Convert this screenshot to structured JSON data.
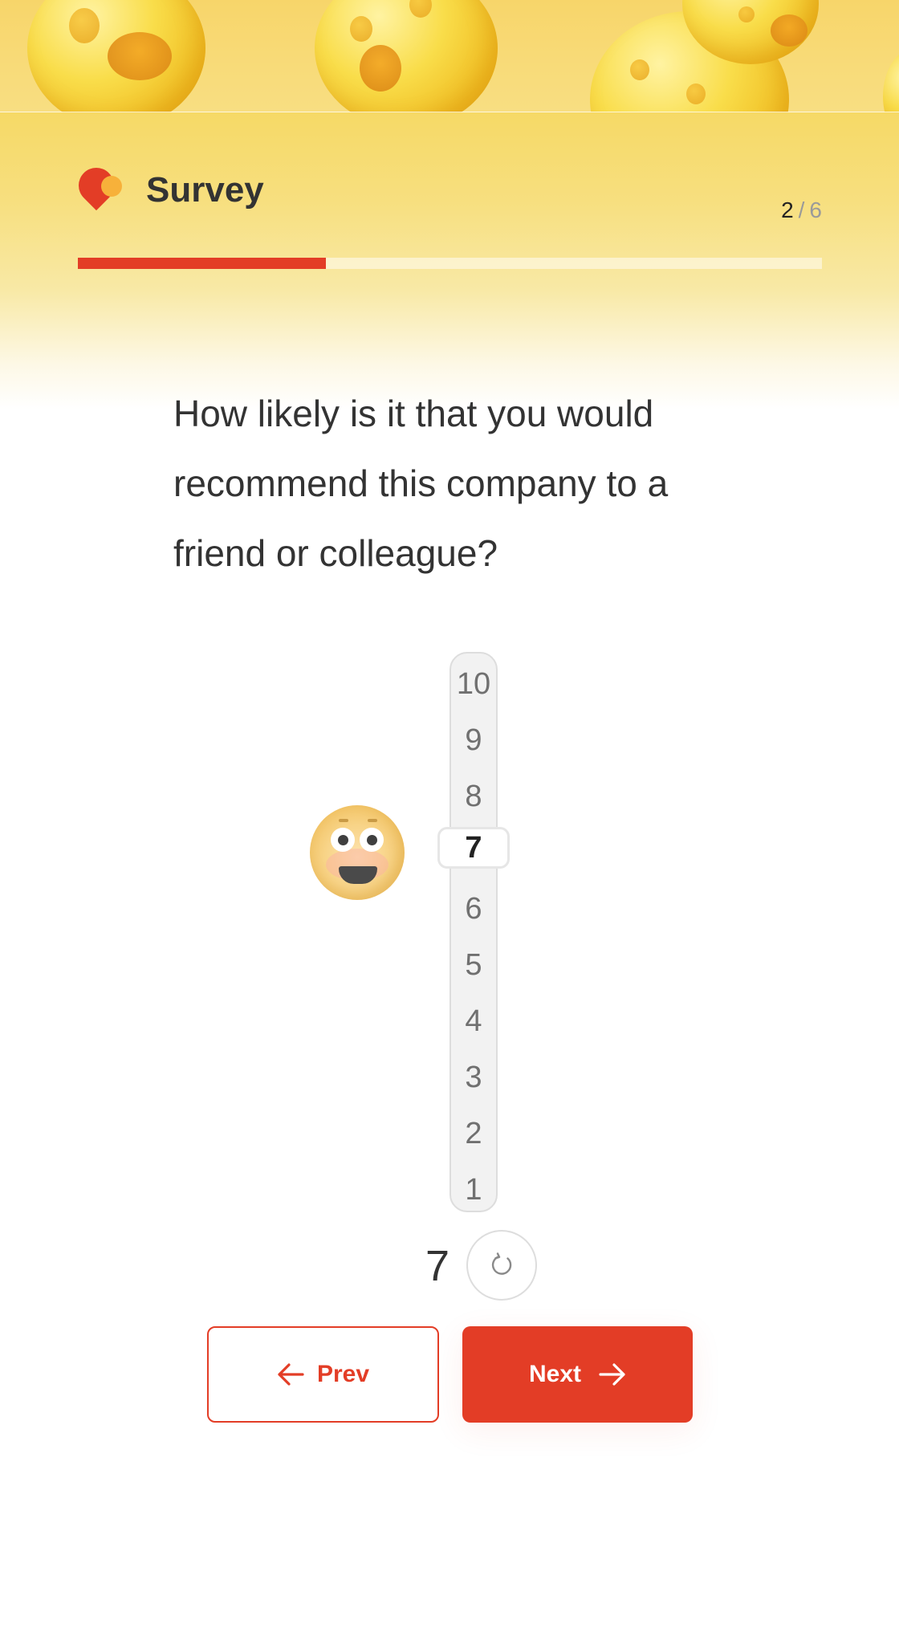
{
  "header": {
    "title": "Survey",
    "step_current": "2",
    "step_separator": "/",
    "step_total": "6",
    "progress_fraction": 0.333
  },
  "question": {
    "text": "How likely is it that you would recommend this company to a friend or colleague?"
  },
  "rating": {
    "options": [
      "10",
      "9",
      "8",
      "7",
      "6",
      "5",
      "4",
      "3",
      "2",
      "1"
    ],
    "selected": "7",
    "value_display": "7"
  },
  "nav": {
    "prev_label": "Prev",
    "next_label": "Next"
  },
  "colors": {
    "accent": "#e33d26",
    "header_yellow": "#f7d56a"
  }
}
